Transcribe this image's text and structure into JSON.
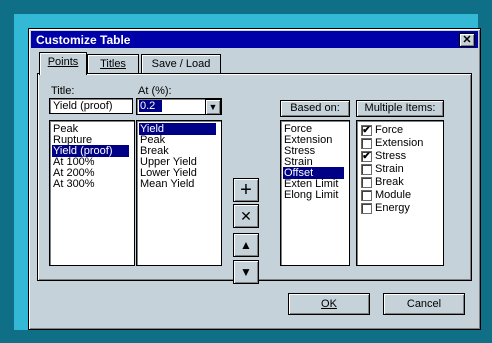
{
  "window": {
    "title": "Customize Table",
    "close_glyph": "✕"
  },
  "tabs": [
    {
      "label": "Points",
      "active": true
    },
    {
      "label": "Titles",
      "active": false
    },
    {
      "label": "Save / Load",
      "active": false
    }
  ],
  "title_field": {
    "label": "Title:",
    "value": "Yield (proof)"
  },
  "title_list": [
    "Peak",
    "Rupture",
    "Yield (proof)",
    "At 100%",
    "At 200%",
    "At 300%"
  ],
  "title_list_selected": "Yield (proof)",
  "at_field": {
    "label": "At (%):",
    "value": "0.2"
  },
  "at_dropdown": [
    "Yield",
    "Peak",
    "Break",
    "Upper Yield",
    "Lower Yield",
    "Mean Yield"
  ],
  "at_dropdown_selected": "Yield",
  "action_buttons": {
    "add": "+",
    "delete": "✕",
    "up": "▲",
    "down": "▼"
  },
  "based_on": {
    "header": "Based on:",
    "items": [
      "Force",
      "Extension",
      "Stress",
      "Strain",
      "Offset",
      "Exten Limit",
      "Elong Limit"
    ],
    "selected": "Offset"
  },
  "multiple_items": {
    "header": "Multiple Items:",
    "items": [
      {
        "label": "Force",
        "checked": true
      },
      {
        "label": "Extension",
        "checked": false
      },
      {
        "label": "Stress",
        "checked": true
      },
      {
        "label": "Strain",
        "checked": false
      },
      {
        "label": "Break",
        "checked": false
      },
      {
        "label": "Module",
        "checked": false
      },
      {
        "label": "Energy",
        "checked": false
      }
    ]
  },
  "footer": {
    "ok": "OK",
    "cancel": "Cancel"
  },
  "colors": {
    "titlebar": "#0000a8",
    "dialog": "#c5d2da",
    "selection": "#000086",
    "desktop": "#0f6f86",
    "frame": "#33b9d6"
  }
}
